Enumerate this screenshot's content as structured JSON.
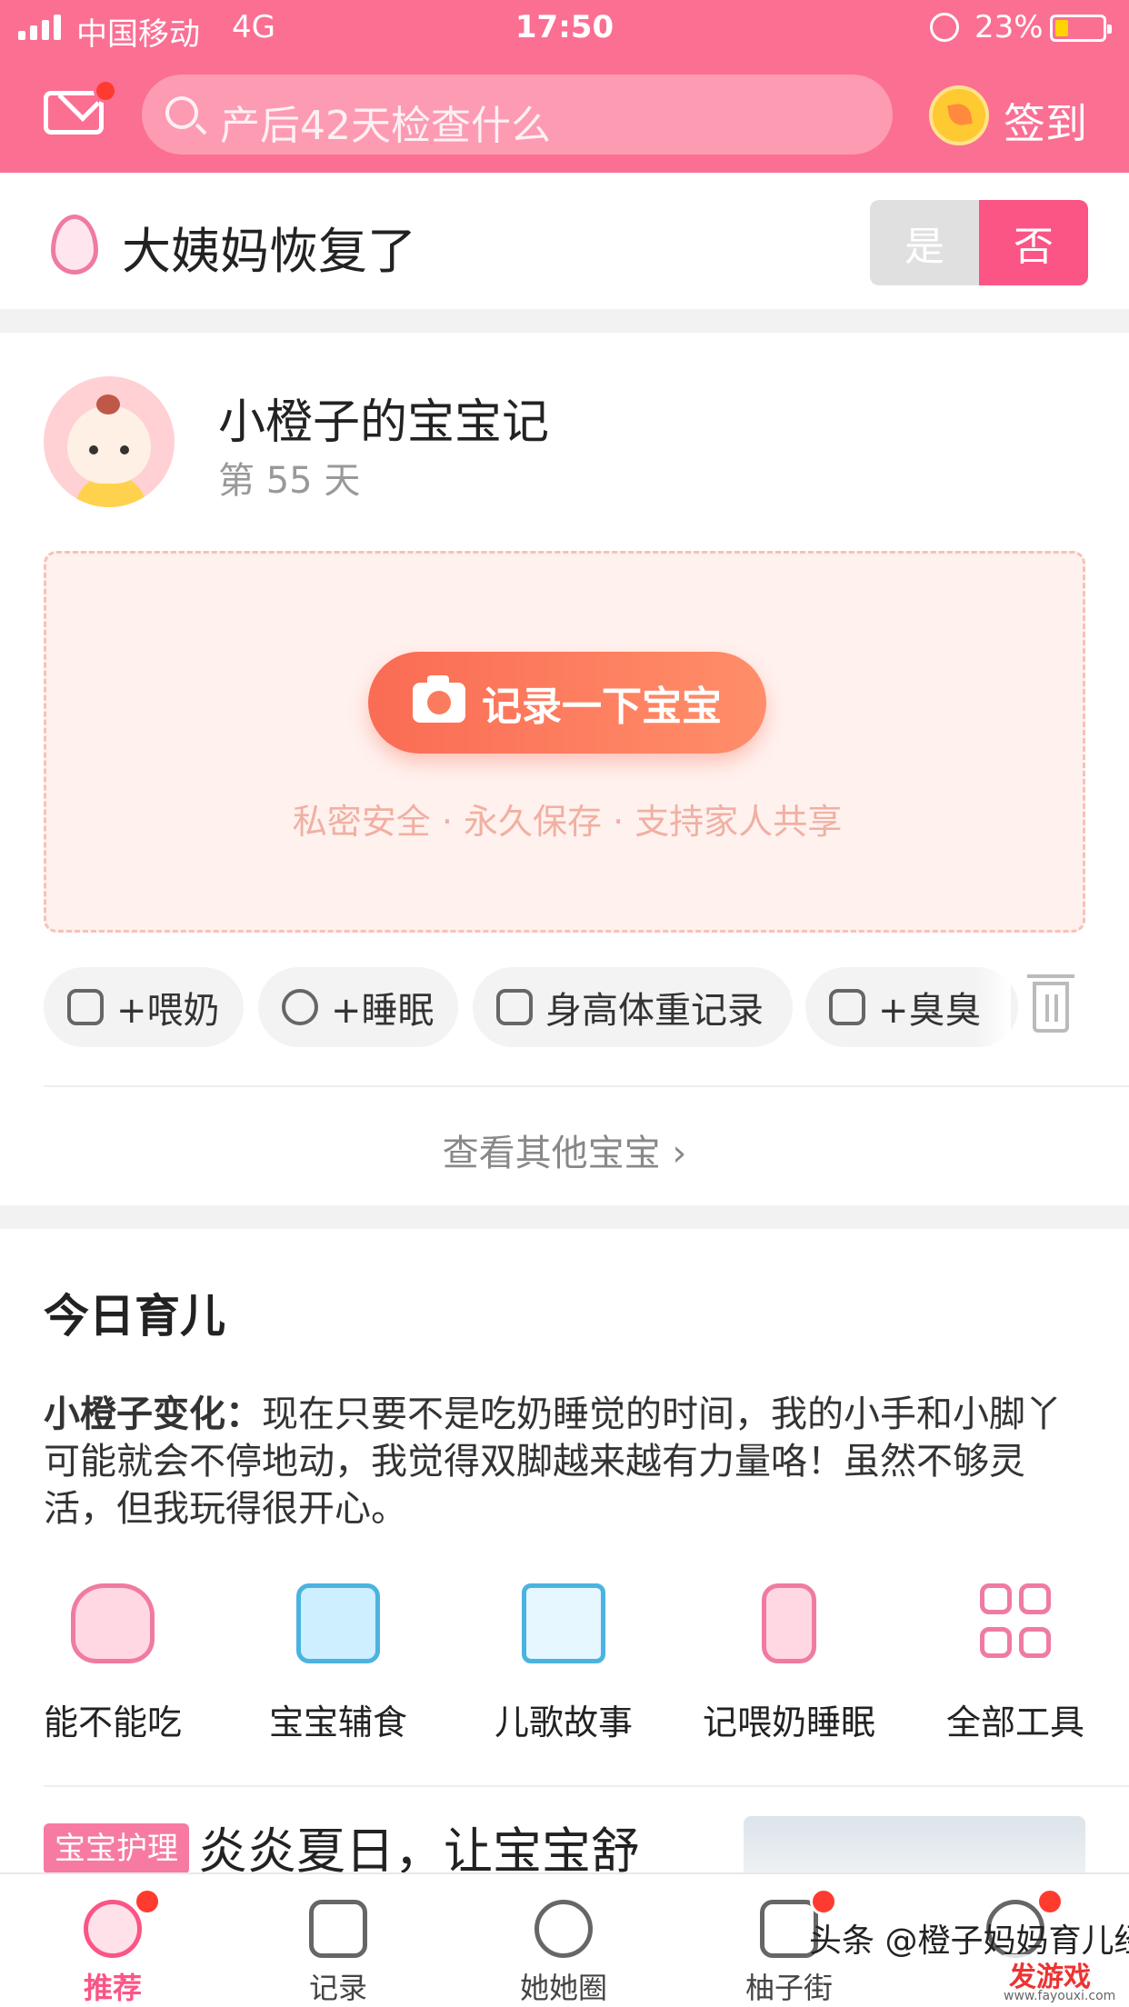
{
  "status": {
    "carrier": "中国移动",
    "network": "4G",
    "time": "17:50",
    "battery": "23%"
  },
  "header": {
    "search_placeholder": "产后42天检查什么",
    "signin_label": "签到"
  },
  "period": {
    "title": "大姨妈恢复了",
    "yes": "是",
    "no": "否"
  },
  "baby": {
    "name": "小橙子的宝宝记",
    "day": "第 55 天",
    "record_button": "记录一下宝宝",
    "perks": "私密安全  ·  永久保存  ·  支持家人共享",
    "chips": [
      "+喂奶",
      "+睡眠",
      "身高体重记录",
      "+臭臭"
    ],
    "view_others": "查看其他宝宝 ›"
  },
  "today": {
    "heading": "今日育儿",
    "desc_label": "小橙子变化：",
    "desc_text": "现在只要不是吃奶睡觉的时间，我的小手和小脚丫可能就会不停地动，我觉得双脚越来越有力量咯！虽然不够灵活，但我玩得很开心。",
    "tools": [
      "能不能吃",
      "宝宝辅食",
      "儿歌故事",
      "记喂奶睡眠",
      "全部工具"
    ],
    "article_tag": "宝宝护理",
    "article_title": "炎炎夏日，让宝宝舒"
  },
  "tabbar": [
    "推荐",
    "记录",
    "她她圈",
    "柚子街",
    ""
  ],
  "watermark": {
    "text": "头条 @橙子妈妈育儿经",
    "logo": "发游戏",
    "url": "www.fayouxi.com"
  },
  "colors": {
    "brand": "#fb6f93",
    "accent": "#fb5585",
    "record_button": "#fa6c54"
  }
}
